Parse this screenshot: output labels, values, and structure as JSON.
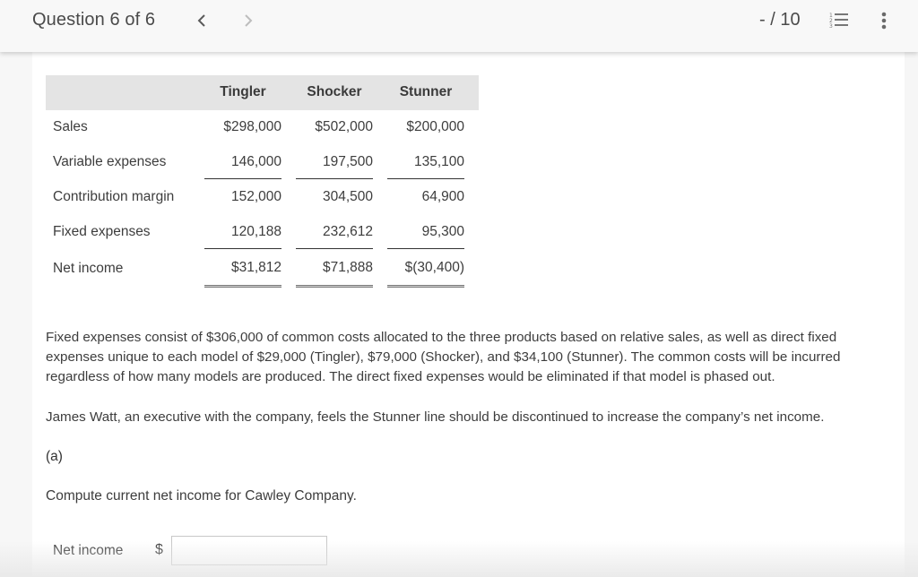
{
  "header": {
    "question_title": "Question 6 of 6",
    "prev_icon": "chevron-left-icon",
    "next_icon": "chevron-right-icon",
    "score": "- / 10",
    "list_icon": "numbered-list-icon",
    "more_icon": "more-vertical-icon"
  },
  "table": {
    "columns": [
      "Tingler",
      "Shocker",
      "Stunner"
    ],
    "rows": [
      {
        "label": "Sales",
        "values": [
          "$298,000",
          "$502,000",
          "$200,000"
        ]
      },
      {
        "label": "Variable expenses",
        "values": [
          "146,000",
          "197,500",
          "135,100"
        ]
      },
      {
        "label": "Contribution margin",
        "values": [
          "152,000",
          "304,500",
          "64,900"
        ]
      },
      {
        "label": "Fixed expenses",
        "values": [
          "120,188",
          "232,612",
          "95,300"
        ]
      },
      {
        "label": "Net income",
        "values": [
          "$31,812",
          "$71,888",
          "$(30,400)"
        ]
      }
    ]
  },
  "body": {
    "paragraph1": "Fixed expenses consist of $306,000 of common costs allocated to the three products based on relative sales, as well as direct fixed expenses unique to each model of $29,000 (Tingler), $79,000 (Shocker), and $34,100 (Stunner). The common costs will be incurred regardless of how many models are produced. The direct fixed expenses would be eliminated if that model is phased out.",
    "paragraph2": "James Watt, an executive with the company, feels the Stunner line should be discontinued to increase the company’s net income.",
    "part_label": "(a)",
    "prompt": "Compute current net income for Cawley Company.",
    "answer": {
      "label": "Net income",
      "currency": "$",
      "value": "",
      "placeholder": ""
    }
  }
}
